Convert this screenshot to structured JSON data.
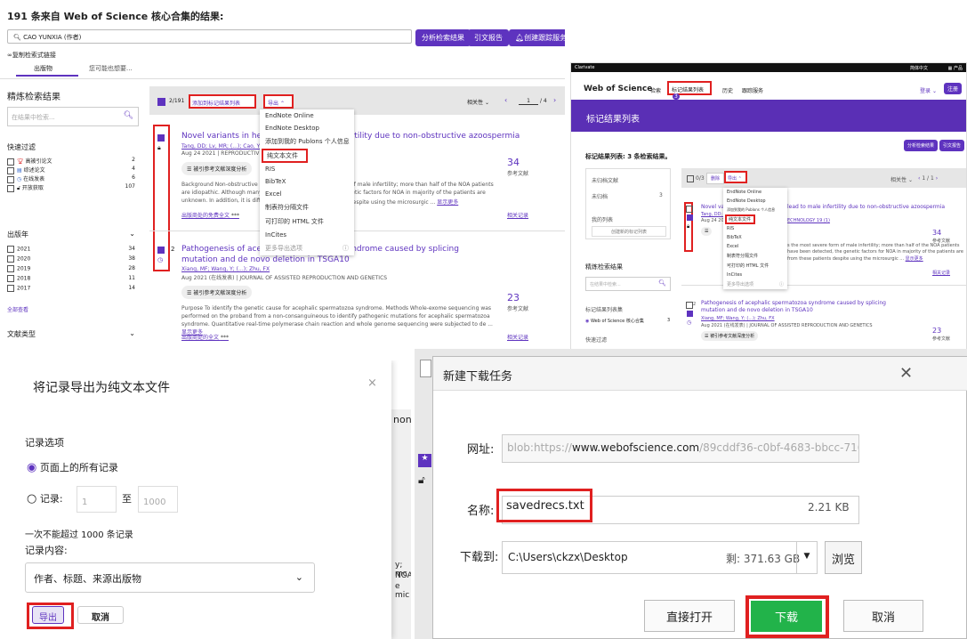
{
  "p1": {
    "heading": "191 条来自 Web of Science 核心合集的结果:",
    "search_value": "CAO YUNXIA (作者)",
    "btn_analyze": "分析检索结果",
    "btn_cite": "引文报告",
    "btn_alert": "创建跟踪服务",
    "copy_link": "复制检索式链接",
    "tab1": "出版物",
    "tab2": "您可能也想要...",
    "refine_title": "精炼检索结果",
    "refine_placeholder": "在结果中检索...",
    "quick_filter": "快速过滤",
    "filters": [
      {
        "label": "高被引论文",
        "count": "2"
      },
      {
        "label": "综述论文",
        "count": "4"
      },
      {
        "label": "在线发表",
        "count": "6"
      },
      {
        "label": "开放获取",
        "count": "107"
      }
    ],
    "year_title": "出版年",
    "years": [
      {
        "label": "2021",
        "count": "34"
      },
      {
        "label": "2020",
        "count": "38"
      },
      {
        "label": "2019",
        "count": "28"
      },
      {
        "label": "2018",
        "count": "11"
      },
      {
        "label": "2017",
        "count": "14"
      }
    ],
    "see_all": "全部查看",
    "doc_type": "文献类型",
    "toolbar_count": "2/191",
    "add_to_list": "添加到标记结果列表",
    "export": "导出",
    "sort": "相关性",
    "page_cur": "1",
    "page_total": "/ 4",
    "menu": [
      "EndNote Online",
      "EndNote Desktop",
      "添加到我的 Publons 个人信息",
      "纯文本文件",
      "RIS",
      "BibTeX",
      "Excel",
      "制表符分隔文件",
      "可打印的 HTML 文件",
      "InCites",
      "更多导出选项"
    ],
    "r1": {
      "title_a": "Novel variants in helicase",
      "title_b": "fertility due to non-obstructive azoospermia",
      "authors": "Tang, DD; Lv, MR; (...); Cao, YX",
      "date": "Aug 24 2021 | REPRODUCTIVE B",
      "pill": "被引参考文献深度分析",
      "abs1": "Background Non-obstructive az",
      "abs1b": "rm of male infertility; more than half of the NOA patients",
      "abs2": "are idiopathic. Although many h",
      "abs2b": "genetic factors for NOA in majority of the patients are",
      "abs3": "unknown. In addition, it is diffic",
      "abs3b": "ds despite using the microsurgic ...",
      "more": "显示更多",
      "fulltext": "出版商处的免费全文",
      "count": "34",
      "count_label": "参考文献",
      "related": "相关记录"
    },
    "r2": {
      "num": "2",
      "title": "Pathogenesis of acephalic spermatozoa syndrome caused by splicing mutation and de novo deletion in TSGA10",
      "authors": "Xiang, MF; Wang, Y; (...); Zhu, FX",
      "date": "Aug 2021 (在线发表) | JOURNAL OF ASSISTED REPRODUCTION AND GENETICS",
      "pill": "被引参考文献深度分析",
      "abs": "Purpose To identify the genetic cause for acephalic spermatozoa syndrome. Methods Whole-exome sequencing was performed on the proband from a non-consanguineous to identify pathogenic mutations for acephalic spermatozoa syndrome. Quantitative real-time polymerase chain reaction and whole genome sequencing were subjected to de ...",
      "more": "显示更多",
      "fulltext": "出版商处的全文",
      "count": "23",
      "count_label": "参考文献",
      "related": "相关记录"
    }
  },
  "p2": {
    "brand": "Clarivate",
    "lang": "简体中文",
    "products": "产品",
    "logo": "Web of Science",
    "nav": [
      "检索",
      "标记结果列表",
      "历史",
      "跟踪服务"
    ],
    "badge": "3",
    "login": "登录",
    "register": "注册",
    "title": "标记结果列表",
    "btn_analyze": "分析检索结果",
    "btn_cite": "引文报告",
    "count_heading": "标记结果列表: 3 条检索结果。",
    "unsaved": "未归档文献",
    "unclassified": "未归档",
    "unclassified_count": "3",
    "mylist": "我的列表",
    "create_list": "创建新的标记列表",
    "refine": "精炼检索结果",
    "refine_placeholder": "在结果中检索...",
    "source_db": "标记结果列表集",
    "source_item": "Web of Science 核心合集",
    "source_count": "3",
    "quick": "快速过滤",
    "toolbar_count": "0/3",
    "delete": "删除",
    "export": "导出",
    "sort": "相关性",
    "page": "1 / 1",
    "menu": [
      "EndNote Online",
      "EndNote Desktop",
      "添加到我的 Publons 个人信息",
      "纯文本文件",
      "RIS",
      "BibTeX",
      "Excel",
      "制表符分隔文件",
      "可打印的 HTML 文件",
      "InCites",
      "更多导出选项"
    ],
    "r1_title": "Novel vari",
    "r1_title_b": "lead to male infertility due to non-obstructive azoospermia",
    "r1_auth": "Tang, DD; Lv",
    "r1_date": "Aug 24 2021",
    "r1_journal": "ECHNOLOGY 19 (1)",
    "r1_count": "34",
    "r1_lbl": "参考文献",
    "r1_abs": "s the most severe form of male infertility; more than half of the NOA patients",
    "r1_abs2": "have been detected, the genetic factors for NOA in majority of the patients are",
    "r1_abs3": "from these patients despite using the microsurgic ...",
    "r1_more": "显示更多",
    "r1_related": "相关记录",
    "r2_num": "2",
    "r2_title": "Pathogenesis of acephalic spermatozoa syndrome caused by splicing mutation and de novo deletion in TSGA10",
    "r2_auth": "Xiang, MF; Wang, Y; (...); Zhu, FX",
    "r2_date": "Aug 2021 (在线发表) | JOURNAL OF ASSISTED REPRODUCTION AND GENETICS",
    "r2_pill": "被引参考文献深度分析",
    "r2_count": "23",
    "r2_lbl": "参考文献"
  },
  "p3": {
    "title": "将记录导出为纯文本文件",
    "section": "记录选项",
    "opt_all": "页面上的所有记录",
    "opt_records": "记录:",
    "from": "1",
    "to_label": "至",
    "to": "1000",
    "limit_note": "一次不能超过 1000 条记录",
    "content_label": "记录内容:",
    "content_value": "作者、标题、来源出版物",
    "export_btn": "导出",
    "cancel_btn": "取消",
    "bg_text": [
      "non-",
      "y; mc",
      "NOA",
      "e mic"
    ]
  },
  "p4": {
    "title": "新建下载任务",
    "url_label": "网址:",
    "url_prefix": "blob:https://",
    "url_domain": "www.webofscience.com",
    "url_rest": "/89cddf36-c0bf-4683-bbcc-716",
    "name_label": "名称:",
    "name_value": "savedrecs.txt",
    "size": "2.21 KB",
    "dest_label": "下载到:",
    "dest_path": "C:\\Users\\ckzx\\Desktop",
    "free": "剩: 371.63 GB",
    "browse": "浏览",
    "open_btn": "直接打开",
    "download_btn": "下载",
    "cancel_btn": "取消"
  }
}
